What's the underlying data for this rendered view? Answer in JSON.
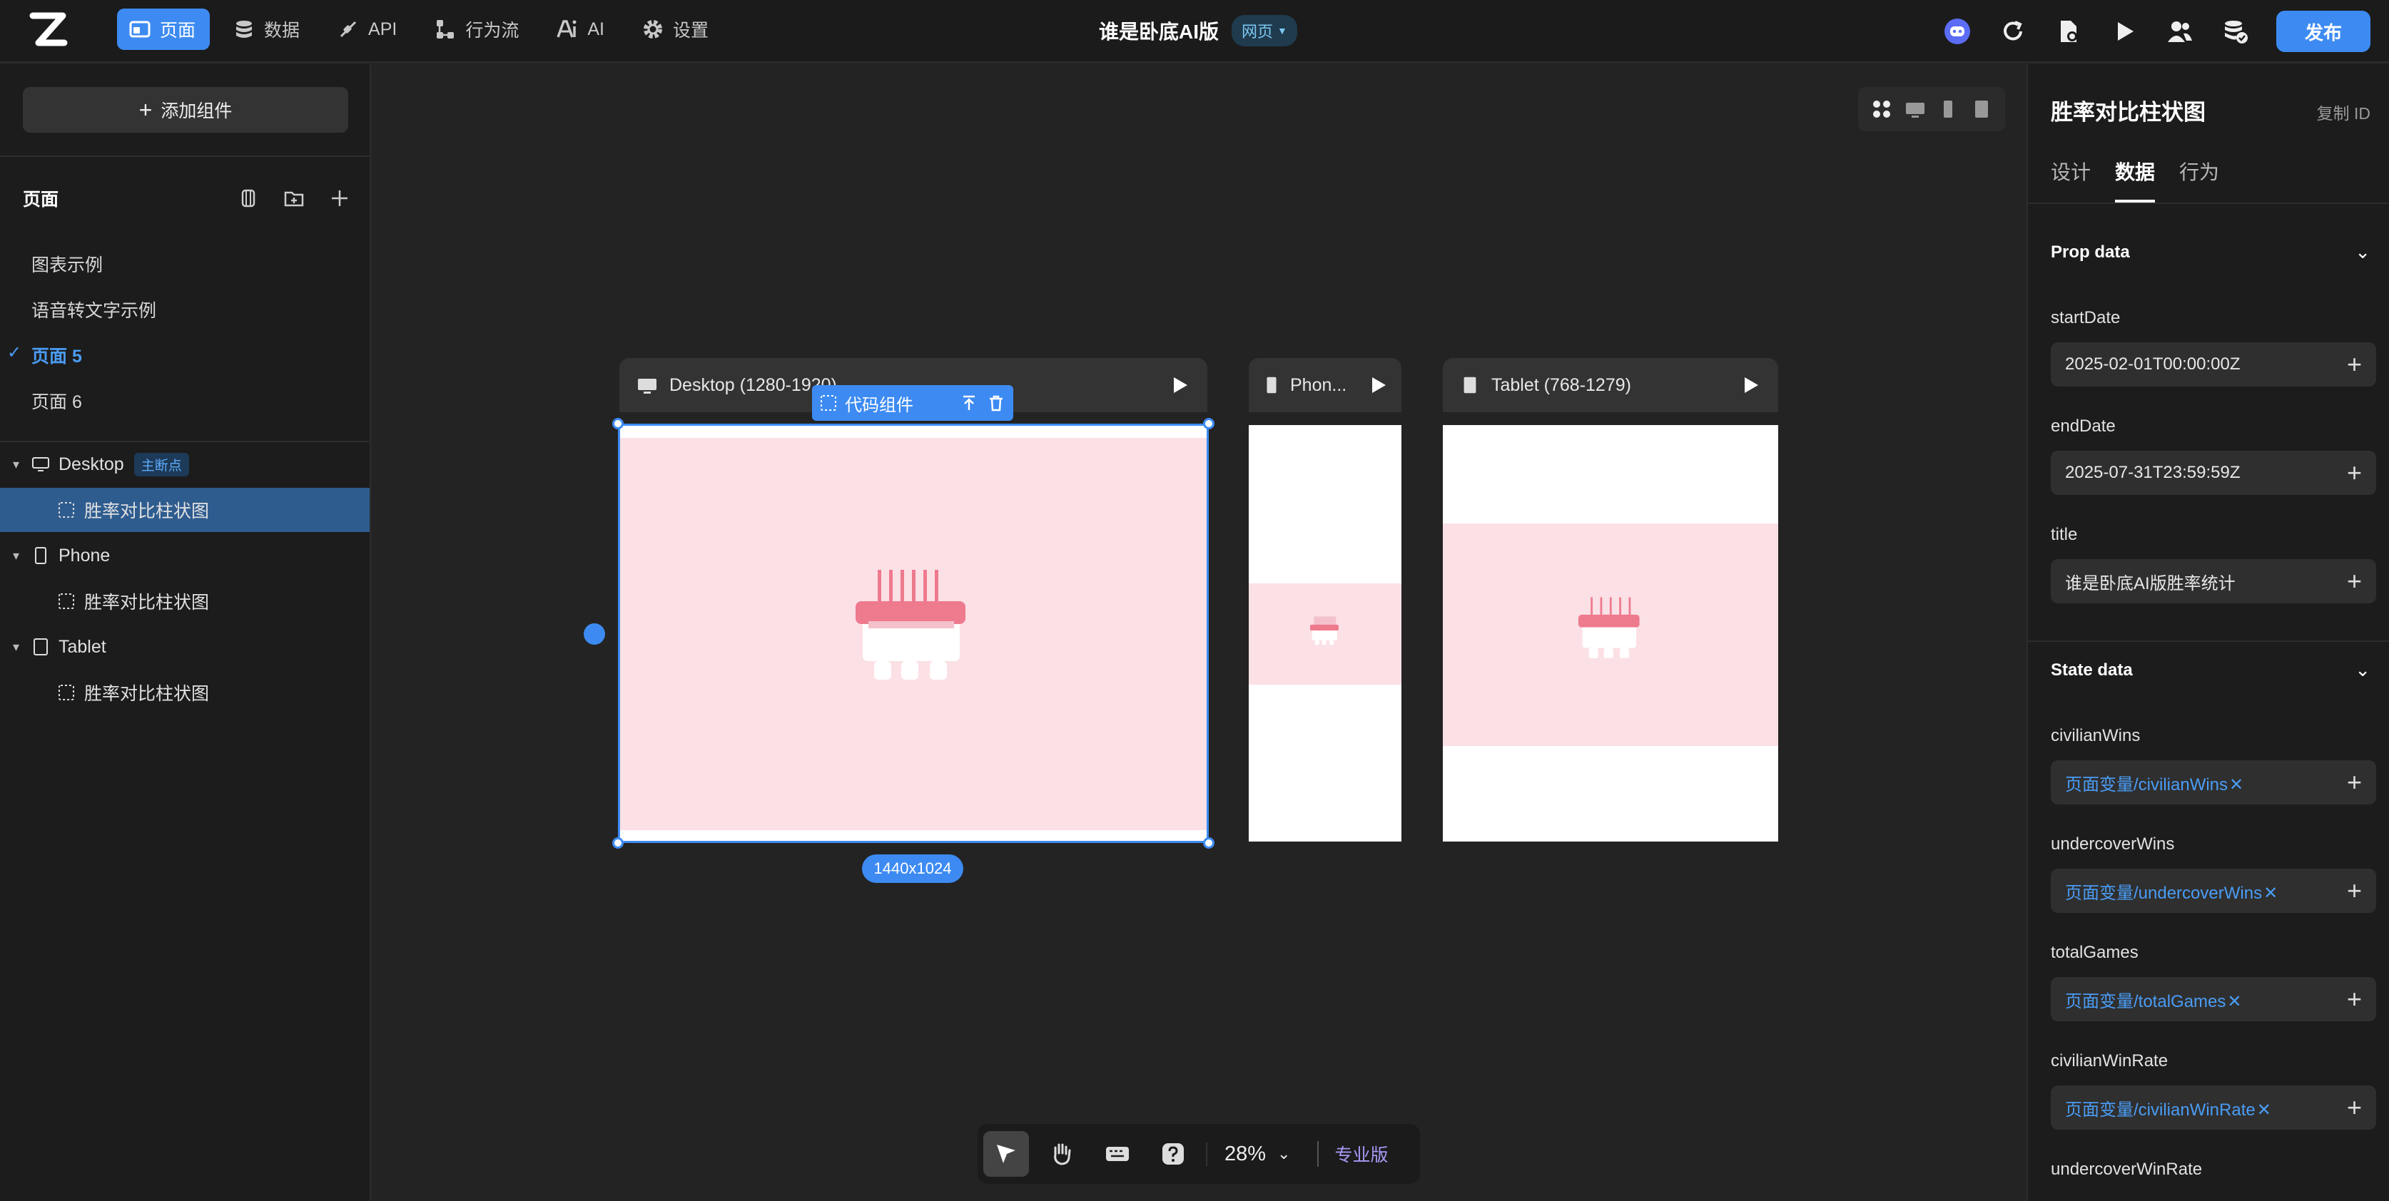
{
  "topbar": {
    "nav": [
      {
        "label": "页面",
        "icon": "pages-icon",
        "active": true
      },
      {
        "label": "数据",
        "icon": "database-icon"
      },
      {
        "label": "API",
        "icon": "api-icon"
      },
      {
        "label": "行为流",
        "icon": "flow-icon"
      },
      {
        "label": "AI",
        "icon": "ai-icon"
      },
      {
        "label": "设置",
        "icon": "gear-icon"
      }
    ],
    "project_name": "谁是卧底AI版",
    "project_type": "网页",
    "publish_label": "发布"
  },
  "left": {
    "add_component_label": "添加组件",
    "pages_title": "页面",
    "pages": [
      "图表示例",
      "语音转文字示例",
      "页面 5",
      "页面 6"
    ],
    "active_page": "页面 5",
    "tree": {
      "desktop": "Desktop",
      "desktop_badge": "主断点",
      "phone": "Phone",
      "tablet": "Tablet",
      "child": "胜率对比柱状图"
    }
  },
  "canvas": {
    "frames": {
      "desktop": "Desktop (1280-1920)",
      "phone": "Phon...",
      "tablet": "Tablet (768-1279)"
    },
    "selected_tag": "代码组件",
    "size_label": "1440x1024",
    "zoom": "28%",
    "pro_label": "专业版",
    "colors": {
      "accent": "#3d8bf2",
      "placeholder_bg": "#fbe0e5",
      "placeholder_fg": "#ee7a8e"
    }
  },
  "right": {
    "title": "胜率对比柱状图",
    "copy_id": "复制 ID",
    "tabs": [
      "设计",
      "数据",
      "行为"
    ],
    "active_tab": "数据",
    "prop_section": "Prop data",
    "props": [
      {
        "name": "startDate",
        "value": "2025-02-01T00:00:00Z"
      },
      {
        "name": "endDate",
        "value": "2025-07-31T23:59:59Z"
      },
      {
        "name": "title",
        "value": "谁是卧底AI版胜率统计"
      }
    ],
    "state_section": "State data",
    "state": [
      {
        "name": "civilianWins",
        "value": "页面变量/civilianWins"
      },
      {
        "name": "undercoverWins",
        "value": "页面变量/undercoverWins"
      },
      {
        "name": "totalGames",
        "value": "页面变量/totalGames"
      },
      {
        "name": "civilianWinRate",
        "value": "页面变量/civilianWinRate"
      },
      {
        "name": "undercoverWinRate",
        "value": ""
      }
    ]
  }
}
